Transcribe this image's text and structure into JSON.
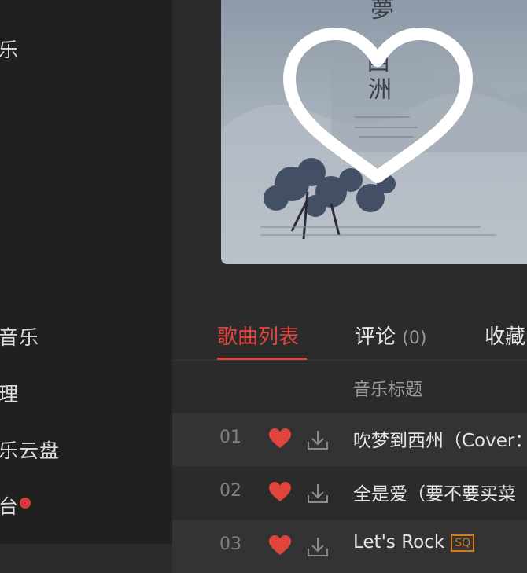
{
  "sidebar": {
    "items": [
      {
        "label": "乐"
      },
      {
        "label": "音乐"
      },
      {
        "label": "理"
      },
      {
        "label": "乐云盘"
      },
      {
        "label": "台"
      }
    ]
  },
  "cover": {
    "text_top": "夢",
    "text_main_1": "西",
    "text_main_2": "洲"
  },
  "tabs": [
    {
      "label": "歌曲列表",
      "count": ""
    },
    {
      "label": "评论",
      "count": "(0)"
    },
    {
      "label": "收藏",
      "count": ""
    }
  ],
  "list": {
    "column_title": "音乐标题",
    "rows": [
      {
        "num": "01",
        "title": "吹梦到西州（Cover："
      },
      {
        "num": "02",
        "title": "全是爱（要不要买菜"
      },
      {
        "num": "03",
        "title": "Let's Rock",
        "tag": "SQ"
      }
    ]
  },
  "colors": {
    "accent": "#e0453d",
    "fav_heart": "#e0453d",
    "tag": "#d77a22"
  }
}
